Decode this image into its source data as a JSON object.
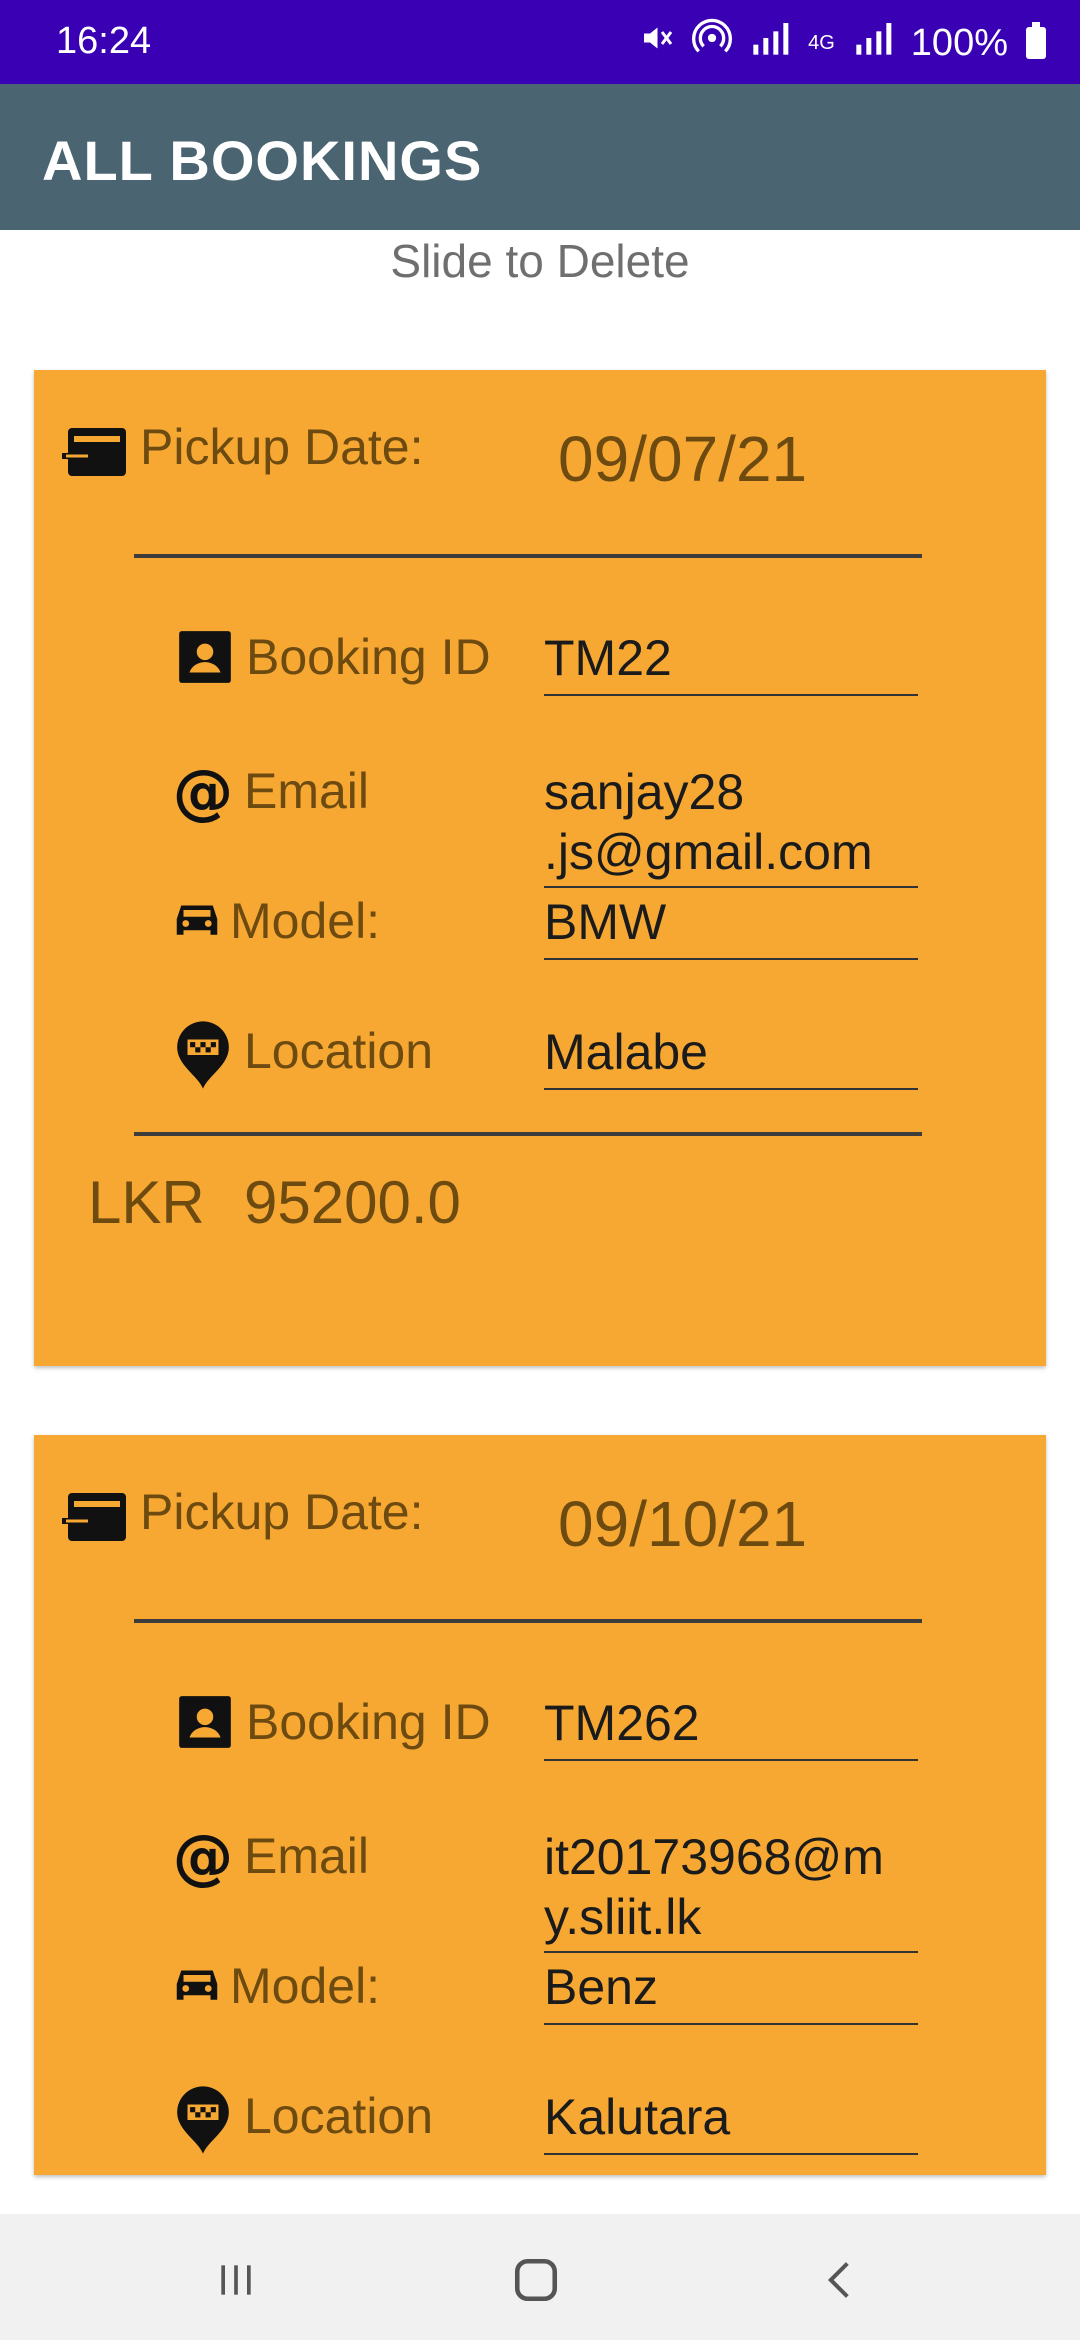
{
  "status_bar": {
    "time": "16:24",
    "battery": "100%",
    "network_label": "4G"
  },
  "app_bar": {
    "title": "ALL BOOKINGS"
  },
  "hint": "Slide to Delete",
  "labels": {
    "pickup_date": "Pickup Date:",
    "booking_id": "Booking ID",
    "email": "Email",
    "model": "Model:",
    "location": "Location"
  },
  "bookings": [
    {
      "pickup_date": "09/07/21",
      "booking_id": "TM22",
      "email_line1": "sanjay28",
      "email_line2": ".js@gmail.com",
      "model": "BMW",
      "location": "Malabe",
      "currency": "LKR",
      "price": "95200.0"
    },
    {
      "pickup_date": "09/10/21",
      "booking_id": "TM262",
      "email_line1": "it20173968@m",
      "email_line2": "y.sliit.lk",
      "model": "Benz",
      "location": "Kalutara"
    }
  ],
  "icons": [
    "calendar-card-icon",
    "contact-icon",
    "at-icon",
    "car-icon",
    "map-pin-icon"
  ],
  "colors": {
    "status_bar": "#3A00B3",
    "app_bar": "#4A6471",
    "card": "#F7A833",
    "label_text": "#6D4A10"
  }
}
